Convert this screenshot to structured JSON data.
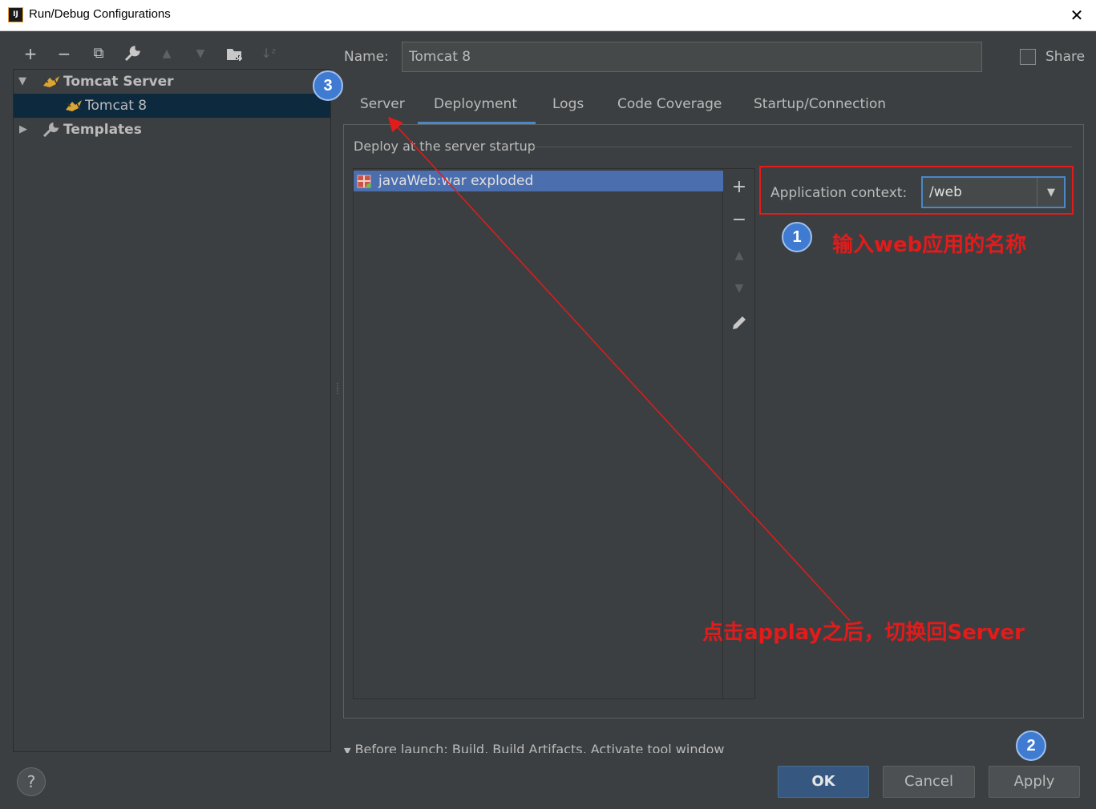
{
  "window": {
    "title": "Run/Debug Configurations",
    "app_icon_text": "IJ",
    "close_glyph": "✕"
  },
  "left_toolbar": {
    "icons": [
      {
        "name": "add-icon",
        "glyph": "+"
      },
      {
        "name": "remove-icon",
        "glyph": "−"
      },
      {
        "name": "copy-icon",
        "glyph": "⧉"
      },
      {
        "name": "wrench-icon",
        "glyph": "🔧"
      },
      {
        "name": "move-up-icon",
        "glyph": "▲"
      },
      {
        "name": "move-down-icon",
        "glyph": "▼"
      },
      {
        "name": "new-folder-icon",
        "glyph": "▰"
      },
      {
        "name": "sort-icon",
        "glyph": "↓ᶻ"
      }
    ]
  },
  "tree": {
    "group": {
      "label": "Tomcat Server",
      "expanded": true
    },
    "child": {
      "label": "Tomcat 8",
      "selected": true
    },
    "templates": {
      "label": "Templates",
      "expanded": false
    }
  },
  "form": {
    "name_label": "Name:",
    "name_value": "Tomcat 8",
    "share_label": "Share",
    "share_checked": false
  },
  "tabs": [
    {
      "label": "Server"
    },
    {
      "label": "Deployment",
      "active": true
    },
    {
      "label": "Logs"
    },
    {
      "label": "Code Coverage"
    },
    {
      "label": "Startup/Connection"
    }
  ],
  "deployment": {
    "section_title": "Deploy at the server startup",
    "items": [
      "javaWeb:war exploded"
    ],
    "app_context_label": "Application context:",
    "app_context_value": "/web"
  },
  "annotations": {
    "badge1": "1",
    "badge2": "2",
    "badge3": "3",
    "note1": "输入web应用的名称",
    "note2": "点击applay之后，切换回Server",
    "color": "#e21b1b"
  },
  "footer": {
    "before_launch": "Before launch: Build, Build Artifacts, Activate tool window",
    "ok_label": "OK",
    "cancel_label": "Cancel",
    "apply_label": "Apply",
    "help_glyph": "?"
  }
}
